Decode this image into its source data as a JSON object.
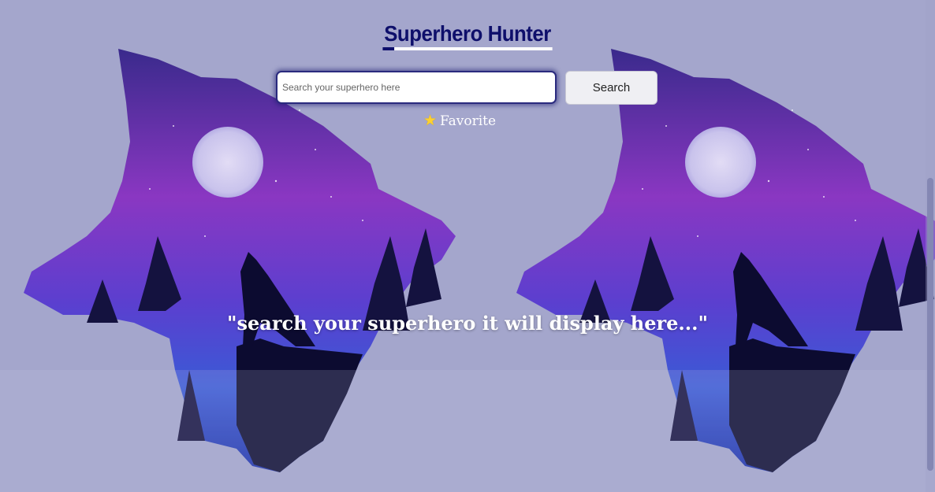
{
  "header": {
    "title": "Superhero Hunter"
  },
  "search": {
    "placeholder": "Search your superhero here",
    "value": "",
    "button_label": "Search"
  },
  "favorite": {
    "icon": "star-icon",
    "label": "Favorite"
  },
  "results": {
    "empty_message": "\"search your superhero it will display here...\""
  },
  "colors": {
    "background": "#a4a6cc",
    "title": "#0e0f6b",
    "accent_star": "#ffd12e"
  }
}
